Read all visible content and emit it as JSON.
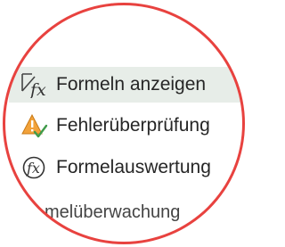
{
  "ribbon": {
    "commands": [
      {
        "label": "Formeln anzeigen",
        "icon": "show-formulas-icon",
        "selected": true
      },
      {
        "label": "Fehlerüberprüfung",
        "icon": "error-checking-icon",
        "selected": false
      },
      {
        "label": "Formelauswertung",
        "icon": "evaluate-formula-icon",
        "selected": false
      }
    ],
    "group_label": "melüberwachung"
  },
  "colors": {
    "ring": "#e8423f",
    "selected_bg": "#e7ede8",
    "warning_fill": "#f2a23a",
    "check_green": "#3f9b4a"
  }
}
